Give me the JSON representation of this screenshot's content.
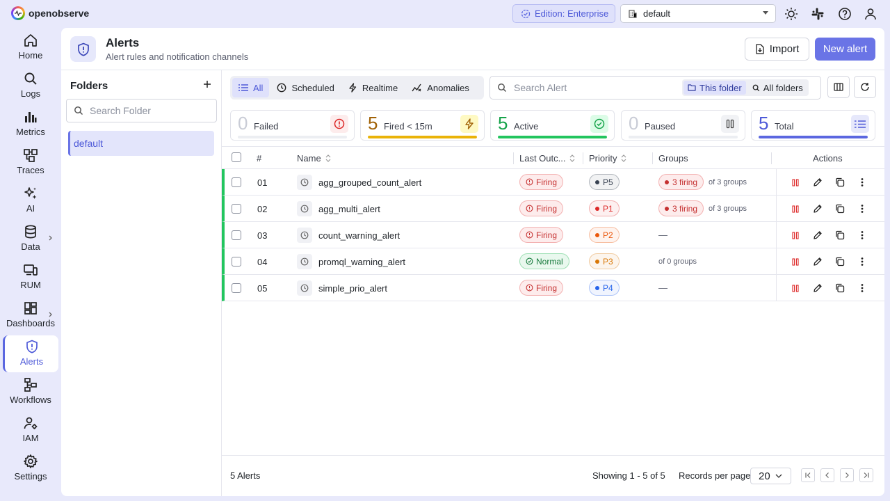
{
  "app": {
    "name": "openobserve"
  },
  "topbar": {
    "edition_label": "Edition: Enterprise",
    "org_value": "default"
  },
  "nav": [
    {
      "label": "Home",
      "icon": "home-icon"
    },
    {
      "label": "Logs",
      "icon": "search-icon"
    },
    {
      "label": "Metrics",
      "icon": "bar-chart-icon"
    },
    {
      "label": "Traces",
      "icon": "traces-icon"
    },
    {
      "label": "AI",
      "icon": "sparkles-icon"
    },
    {
      "label": "Data",
      "icon": "database-icon"
    },
    {
      "label": "RUM",
      "icon": "devices-icon"
    },
    {
      "label": "Dashboards",
      "icon": "dashboard-icon"
    },
    {
      "label": "Alerts",
      "icon": "shield-alert-icon"
    },
    {
      "label": "Workflows",
      "icon": "workflow-icon"
    },
    {
      "label": "IAM",
      "icon": "user-gear-icon"
    },
    {
      "label": "Settings",
      "icon": "gear-icon"
    }
  ],
  "header": {
    "title": "Alerts",
    "subtitle": "Alert rules and notification channels",
    "import_label": "Import",
    "new_label": "New alert"
  },
  "folders": {
    "title": "Folders",
    "search_placeholder": "Search Folder",
    "items": [
      "default"
    ]
  },
  "tabs": [
    "All",
    "Scheduled",
    "Realtime",
    "Anomalies"
  ],
  "search": {
    "placeholder": "Search Alert",
    "scope_this": "This folder",
    "scope_all": "All folders"
  },
  "stats": [
    {
      "value": "0",
      "label": "Failed",
      "color": "#dc2626",
      "fraction": 0
    },
    {
      "value": "5",
      "label": "Fired < 15m",
      "color": "#eab308",
      "fraction": 1
    },
    {
      "value": "5",
      "label": "Active",
      "color": "#22c55e",
      "fraction": 1
    },
    {
      "value": "0",
      "label": "Paused",
      "color": "#6b7280",
      "fraction": 0
    },
    {
      "value": "5",
      "label": "Total",
      "color": "#5b67e0",
      "fraction": 1
    }
  ],
  "table": {
    "columns": [
      "#",
      "Name",
      "Last Outc...",
      "Priority",
      "Groups",
      "Actions"
    ],
    "rows": [
      {
        "num": "01",
        "name": "agg_grouped_count_alert",
        "status": "Firing",
        "priority": "P5",
        "group_badge": "3 firing",
        "group_text": "of 3 groups"
      },
      {
        "num": "02",
        "name": "agg_multi_alert",
        "status": "Firing",
        "priority": "P1",
        "group_badge": "3 firing",
        "group_text": "of 3 groups"
      },
      {
        "num": "03",
        "name": "count_warning_alert",
        "status": "Firing",
        "priority": "P2",
        "group_badge": "",
        "group_text": "—"
      },
      {
        "num": "04",
        "name": "promql_warning_alert",
        "status": "Normal",
        "priority": "P3",
        "group_badge": "",
        "group_text": "of 0 groups"
      },
      {
        "num": "05",
        "name": "simple_prio_alert",
        "status": "Firing",
        "priority": "P4",
        "group_badge": "",
        "group_text": "—"
      }
    ]
  },
  "priority_colors": {
    "P1": "#dc2626",
    "P2": "#ea580c",
    "P3": "#d97706",
    "P4": "#2563eb",
    "P5": "#374151"
  },
  "footer": {
    "count_label": "5 Alerts",
    "showing": "Showing 1 - 5 of 5",
    "rpp_label": "Records per page",
    "rpp_value": "20"
  }
}
